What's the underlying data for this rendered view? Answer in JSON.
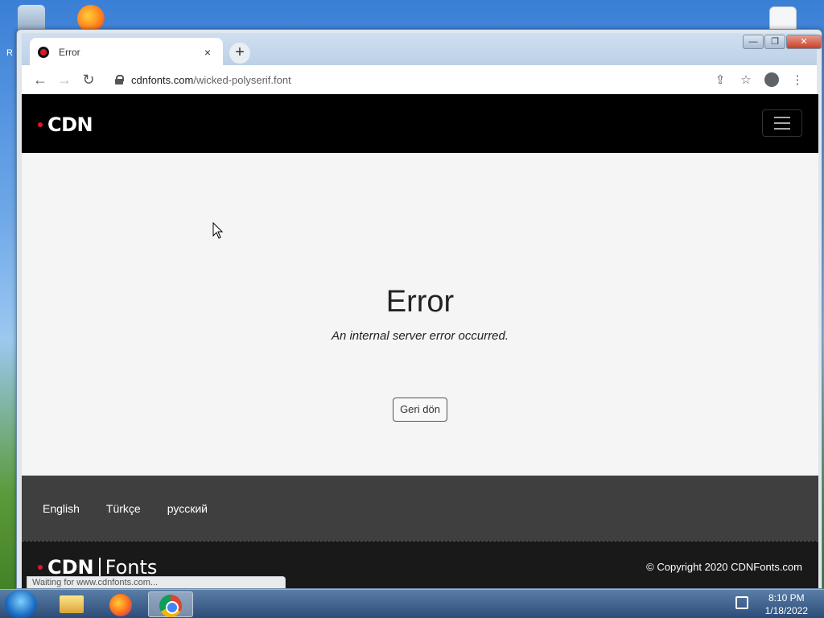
{
  "desktop": {
    "label_left": "R"
  },
  "browser": {
    "tab_title": "Error",
    "tab_close": "×",
    "new_tab": "+",
    "url_host": "cdnfonts.com",
    "url_path": "/wicked-polyserif.font",
    "back": "←",
    "forward": "→",
    "reload": "↻",
    "share": "⇪",
    "star": "☆",
    "menu": "⋮",
    "win_min": "—",
    "win_max": "❐",
    "win_close": "✕",
    "status_text": "Waiting for www.cdnfonts.com..."
  },
  "site": {
    "logo_text": "CDN",
    "error_title": "Error",
    "error_message": "An internal server error occurred.",
    "back_button": "Geri dön",
    "languages": [
      "English",
      "Türkçe",
      "русский"
    ],
    "footer_logo_cdn": "CDN",
    "footer_logo_fonts": "Fonts",
    "copyright": "© Copyright 2020 CDNFonts.com",
    "accent_color": "#e0162b"
  },
  "taskbar": {
    "time": "8:10 PM",
    "date": "1/18/2022"
  }
}
